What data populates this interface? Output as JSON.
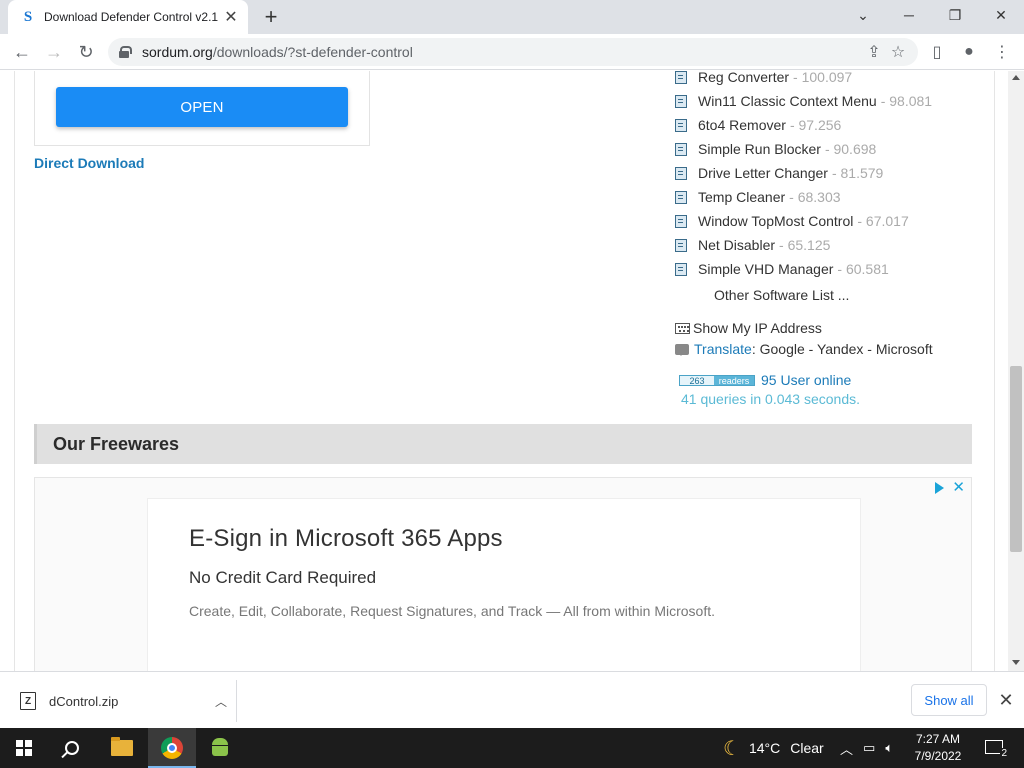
{
  "browser": {
    "tab_title": "Download Defender Control v2.1",
    "tab_favicon": "S",
    "url_host": "sordum.org",
    "url_path": "/downloads/?st-defender-control",
    "icons": [
      "back-arrow-icon",
      "forward-arrow-icon",
      "reload-icon",
      "lock-icon",
      "share-icon",
      "star-icon",
      "side-panel-icon",
      "profile-icon",
      "more-menu-icon"
    ]
  },
  "left": {
    "open_button": "OPEN",
    "direct_download": "Direct Download"
  },
  "software_list": [
    {
      "name": "Reg Converter",
      "count": "- 100.097"
    },
    {
      "name": "Win11 Classic Context Menu",
      "count": "- 98.081"
    },
    {
      "name": "6to4 Remover",
      "count": "- 97.256"
    },
    {
      "name": "Simple Run Blocker",
      "count": "- 90.698"
    },
    {
      "name": "Drive Letter Changer",
      "count": "- 81.579"
    },
    {
      "name": "Temp Cleaner",
      "count": "- 68.303"
    },
    {
      "name": "Window TopMost Control",
      "count": "- 67.017"
    },
    {
      "name": "Net Disabler",
      "count": "- 65.125"
    },
    {
      "name": "Simple VHD Manager",
      "count": "- 60.581"
    }
  ],
  "sidebar": {
    "other_software": "Other Software List ...",
    "show_ip": "Show My IP Address",
    "translate_link": "Translate",
    "translate_rest": " : Google - Yandex - Microsoft",
    "readers_count": "263",
    "readers_label": "readers",
    "users_online": "95 User online",
    "queries": "41 queries in 0.043 seconds."
  },
  "section": {
    "freewares_title": "Our Freewares"
  },
  "ad": {
    "title": "E-Sign in Microsoft 365 Apps",
    "subtitle": "No Credit Card Required",
    "description": "Create, Edit, Collaborate, Request Signatures, and Track — All from within Microsoft."
  },
  "downloads": {
    "file_name": "dControl.zip",
    "show_all": "Show all"
  },
  "taskbar": {
    "temperature": "14°C",
    "weather": "Clear",
    "time": "7:27 AM",
    "date": "7/9/2022",
    "notifications": "2"
  },
  "colors": {
    "accent": "#1a8cf5",
    "link": "#1c7bb8",
    "muted_count": "#aaaaaa",
    "queries": "#5bbad5"
  }
}
